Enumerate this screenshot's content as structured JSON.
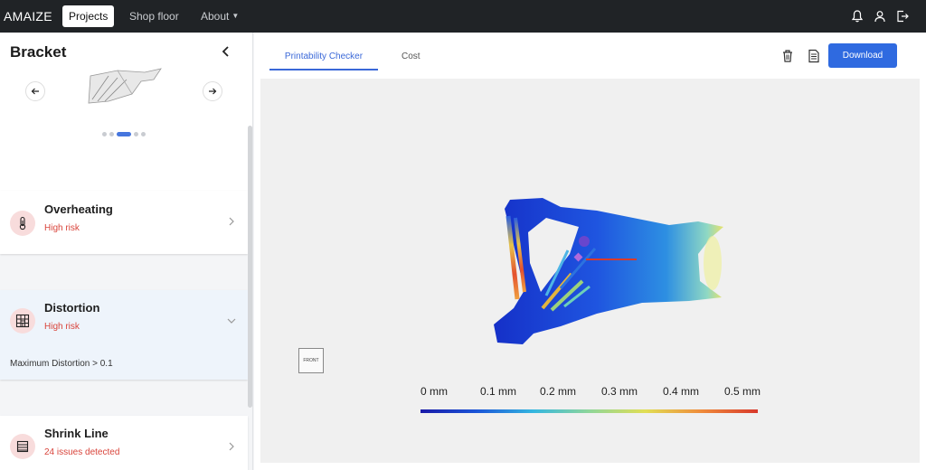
{
  "nav": {
    "brand": "AMAIZE",
    "items": [
      {
        "label": "Projects",
        "active": true
      },
      {
        "label": "Shop floor",
        "active": false
      },
      {
        "label": "About",
        "active": false
      }
    ],
    "icons": [
      "bell-icon",
      "user-icon",
      "logout-icon"
    ]
  },
  "left_panel": {
    "title": "Bracket",
    "carousel": {
      "dot_count": 5,
      "active_dot": 3
    },
    "cards": [
      {
        "title": "Overheating",
        "status": "High risk",
        "icon": "thermometer-icon",
        "expanded": false
      },
      {
        "title": "Distortion",
        "status": "High risk",
        "icon": "grid-icon",
        "expanded": true,
        "note": "Maximum Distortion > 0.1"
      },
      {
        "title": "Shrink Line",
        "status": "24 issues detected",
        "icon": "layers-icon",
        "expanded": false
      }
    ]
  },
  "main": {
    "tabs": [
      {
        "label": "Printability Checker",
        "active": true
      },
      {
        "label": "Cost",
        "active": false
      }
    ],
    "download_label": "Download",
    "viewer": {
      "orientation_label": "FRONT",
      "legend": {
        "labels": [
          "0 mm",
          "0.1 mm",
          "0.2 mm",
          "0.3 mm",
          "0.4 mm",
          "0.5 mm"
        ],
        "min": 0,
        "max": 0.5,
        "unit": "mm"
      }
    }
  },
  "colors": {
    "nav_bg": "#202326",
    "accent": "#2f6ae0",
    "risk": "#d9443b"
  }
}
